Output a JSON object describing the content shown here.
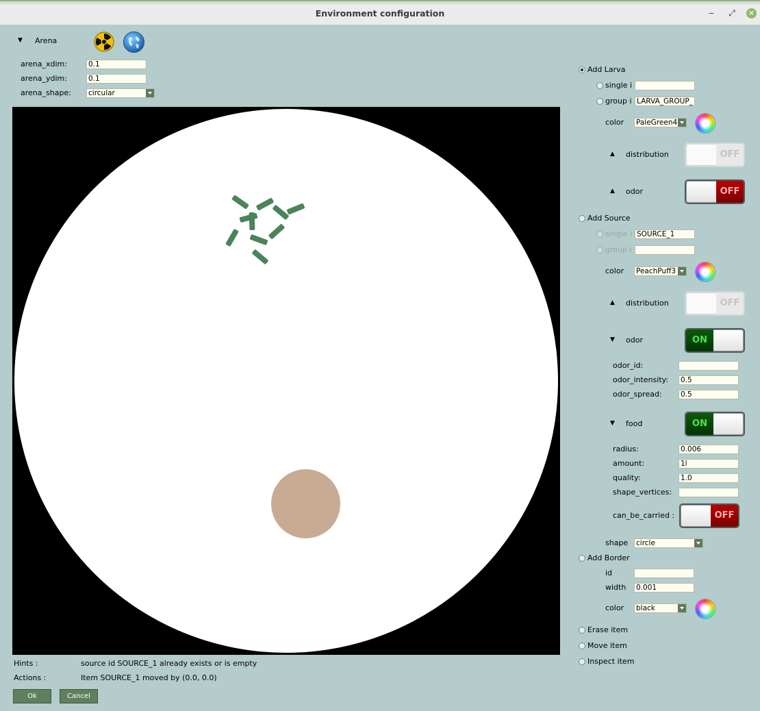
{
  "window": {
    "title": "Environment configuration",
    "minimize": "‒",
    "restore": "⤢",
    "close": "✕"
  },
  "arena": {
    "section_label": "Arena",
    "fields": [
      {
        "label": "arena_xdim:",
        "value": "0.1"
      },
      {
        "label": "arena_ydim:",
        "value": "0.1"
      }
    ],
    "shape_label": "arena_shape:",
    "shape_value": "circular"
  },
  "canvas": {
    "arena_color": "#ffffff",
    "background_color": "#000000",
    "larva_color": "#4a845a",
    "source_color": "#c8ab93"
  },
  "add_larva": {
    "label": "Add Larva",
    "selected": true,
    "single_label": "single i",
    "single_value": "",
    "group_label": "group i",
    "group_value": "LARVA_GROUP_",
    "color_label": "color",
    "color_value": "PaleGreen4",
    "distribution_label": "distribution",
    "distribution_state": "OFF",
    "odor_label": "odor",
    "odor_state": "OFF"
  },
  "add_source": {
    "label": "Add Source",
    "single_label": "single i",
    "single_value": "SOURCE_1",
    "group_label": "group i",
    "group_value": "",
    "color_label": "color",
    "color_value": "PeachPuff3",
    "distribution_label": "distribution",
    "distribution_state": "OFF",
    "odor_label": "odor",
    "odor_state": "ON",
    "odor_fields": [
      {
        "label": "odor_id:",
        "value": ""
      },
      {
        "label": "odor_intensity:",
        "value": "0.5"
      },
      {
        "label": "odor_spread:",
        "value": "0.5"
      }
    ],
    "food_label": "food",
    "food_state": "ON",
    "food_fields": [
      {
        "label": "radius:",
        "value": "0.006"
      },
      {
        "label": "amount:",
        "value": "1l"
      },
      {
        "label": "quality:",
        "value": "1.0"
      },
      {
        "label": "shape_vertices:",
        "value": ""
      }
    ],
    "carried_label": "can_be_carried :",
    "carried_state": "OFF",
    "shape_label": "shape",
    "shape_value": "circle"
  },
  "add_border": {
    "label": "Add Border",
    "id_label": "id",
    "id_value": "",
    "width_label": "width",
    "width_value": "0.001",
    "color_label": "color",
    "color_value": "black"
  },
  "modes": {
    "erase": "Erase item",
    "move": "Move item",
    "inspect": "Inspect item"
  },
  "status": {
    "hints_label": "Hints :",
    "hints_text": "source id SOURCE_1 already exists or is empty",
    "actions_label": "Actions :",
    "actions_text": "Item SOURCE_1 moved by (0.0, 0.0)"
  },
  "buttons": {
    "ok": "Ok",
    "cancel": "Cancel"
  }
}
